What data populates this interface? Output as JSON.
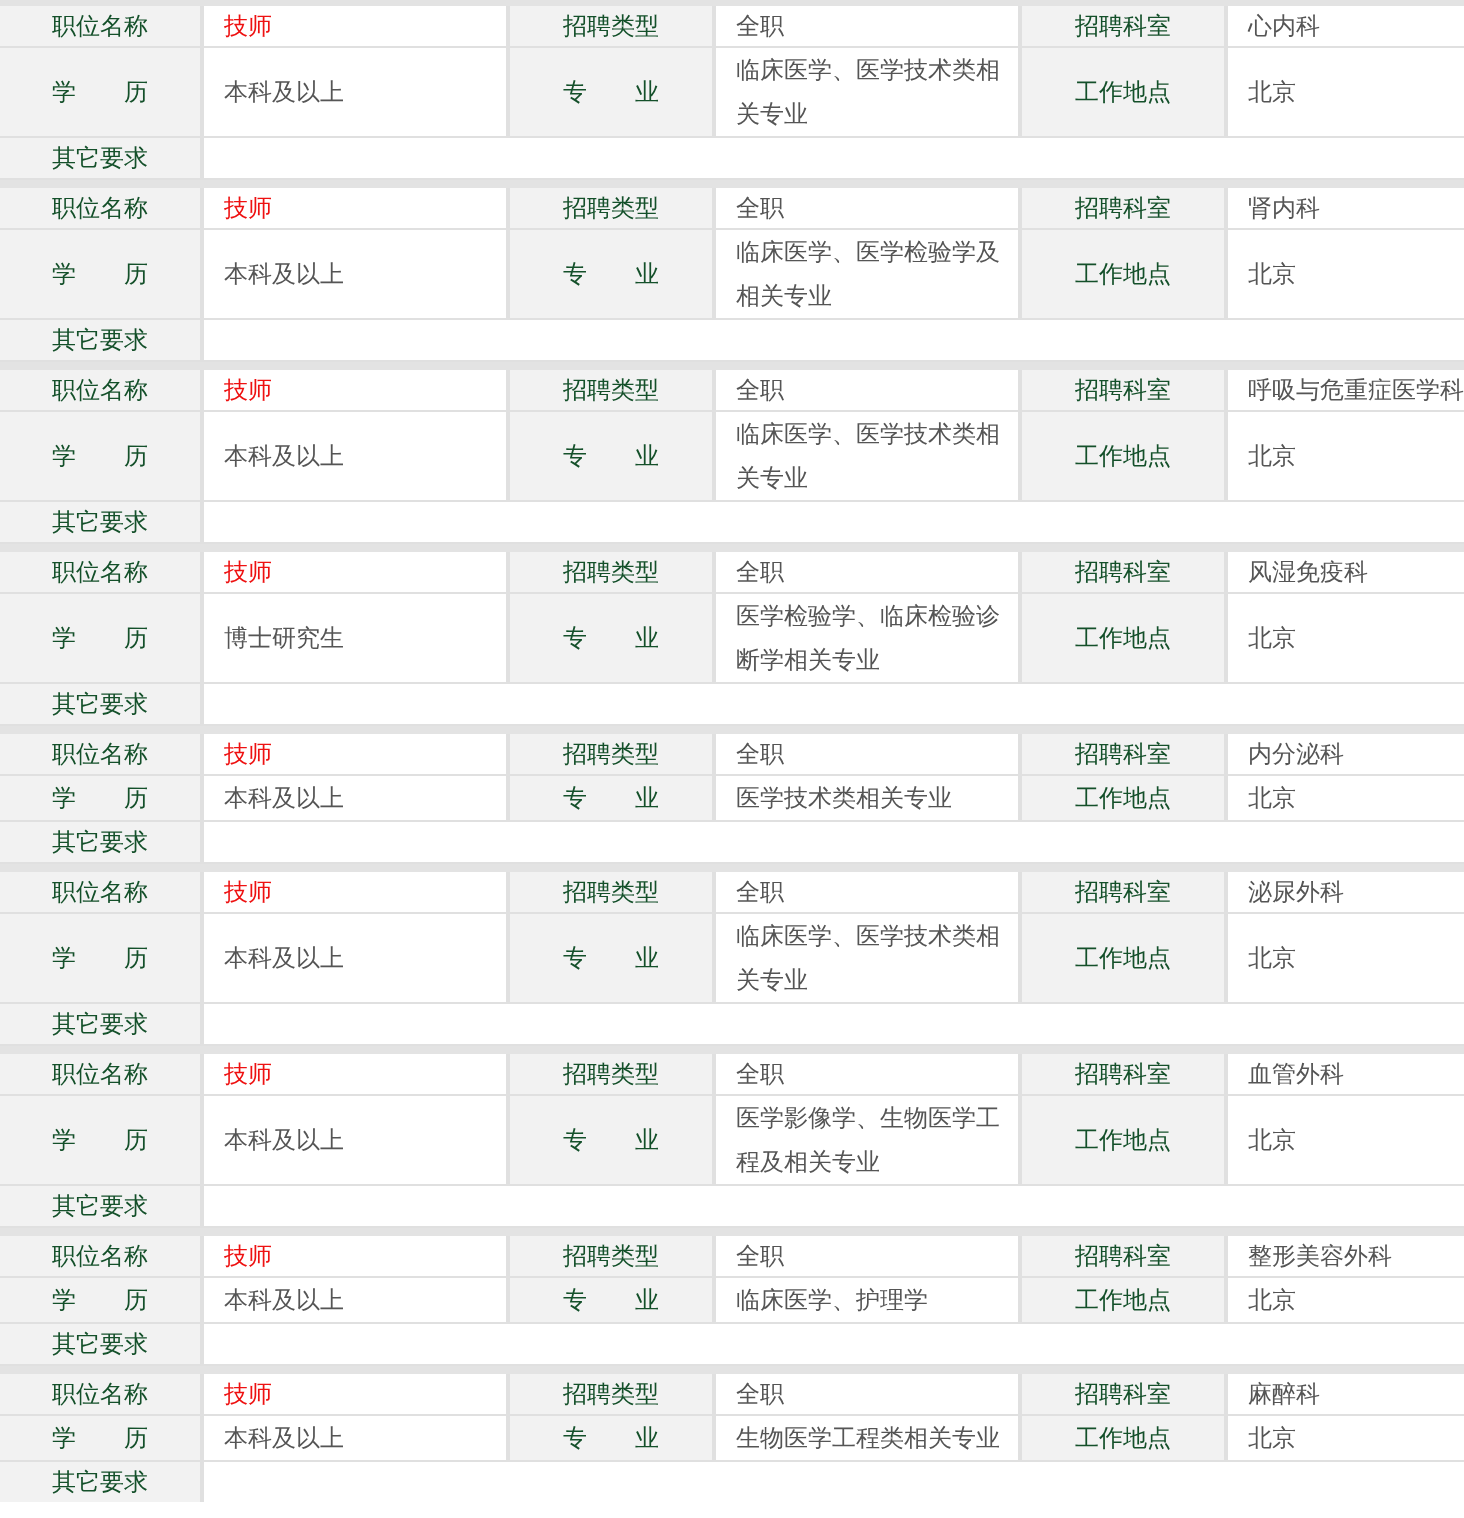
{
  "postings": [
    {
      "title_label": "职位名称",
      "title": "技师",
      "type_label": "招聘类型",
      "type": "全职",
      "dept_label": "招聘科室",
      "dept": "心内科",
      "edu_label": "学　　历",
      "edu": "本科及以上",
      "major_label": "专　　业",
      "major": "临床医学、医学技术类相关专业",
      "loc_label": "工作地点",
      "loc": "北京",
      "other_label": "其它要求"
    },
    {
      "title_label": "职位名称",
      "title": "技师",
      "type_label": "招聘类型",
      "type": "全职",
      "dept_label": "招聘科室",
      "dept": "肾内科",
      "edu_label": "学　　历",
      "edu": "本科及以上",
      "major_label": "专　　业",
      "major": "临床医学、医学检验学及相关专业",
      "loc_label": "工作地点",
      "loc": "北京",
      "other_label": "其它要求"
    },
    {
      "title_label": "职位名称",
      "title": "技师",
      "type_label": "招聘类型",
      "type": "全职",
      "dept_label": "招聘科室",
      "dept": "呼吸与危重症医学科",
      "edu_label": "学　　历",
      "edu": "本科及以上",
      "major_label": "专　　业",
      "major": "临床医学、医学技术类相关专业",
      "loc_label": "工作地点",
      "loc": "北京",
      "other_label": "其它要求"
    },
    {
      "title_label": "职位名称",
      "title": "技师",
      "type_label": "招聘类型",
      "type": "全职",
      "dept_label": "招聘科室",
      "dept": "风湿免疫科",
      "edu_label": "学　　历",
      "edu": "博士研究生",
      "major_label": "专　　业",
      "major": "医学检验学、临床检验诊断学相关专业",
      "loc_label": "工作地点",
      "loc": "北京",
      "other_label": "其它要求"
    },
    {
      "title_label": "职位名称",
      "title": "技师",
      "type_label": "招聘类型",
      "type": "全职",
      "dept_label": "招聘科室",
      "dept": "内分泌科",
      "edu_label": "学　　历",
      "edu": "本科及以上",
      "major_label": "专　　业",
      "major": "医学技术类相关专业",
      "loc_label": "工作地点",
      "loc": "北京",
      "other_label": "其它要求"
    },
    {
      "title_label": "职位名称",
      "title": "技师",
      "type_label": "招聘类型",
      "type": "全职",
      "dept_label": "招聘科室",
      "dept": "泌尿外科",
      "edu_label": "学　　历",
      "edu": "本科及以上",
      "major_label": "专　　业",
      "major": "临床医学、医学技术类相关专业",
      "loc_label": "工作地点",
      "loc": "北京",
      "other_label": "其它要求"
    },
    {
      "title_label": "职位名称",
      "title": "技师",
      "type_label": "招聘类型",
      "type": "全职",
      "dept_label": "招聘科室",
      "dept": "血管外科",
      "edu_label": "学　　历",
      "edu": "本科及以上",
      "major_label": "专　　业",
      "major": "医学影像学、生物医学工程及相关专业",
      "loc_label": "工作地点",
      "loc": "北京",
      "other_label": "其它要求"
    },
    {
      "title_label": "职位名称",
      "title": "技师",
      "type_label": "招聘类型",
      "type": "全职",
      "dept_label": "招聘科室",
      "dept": "整形美容外科",
      "edu_label": "学　　历",
      "edu": "本科及以上",
      "major_label": "专　　业",
      "major": "临床医学、护理学",
      "loc_label": "工作地点",
      "loc": "北京",
      "other_label": "其它要求"
    },
    {
      "title_label": "职位名称",
      "title": "技师",
      "type_label": "招聘类型",
      "type": "全职",
      "dept_label": "招聘科室",
      "dept": "麻醉科",
      "edu_label": "学　　历",
      "edu": "本科及以上",
      "major_label": "专　　业",
      "major": "生物医学工程类相关专业",
      "loc_label": "工作地点",
      "loc": "北京",
      "other_label": "其它要求"
    }
  ]
}
